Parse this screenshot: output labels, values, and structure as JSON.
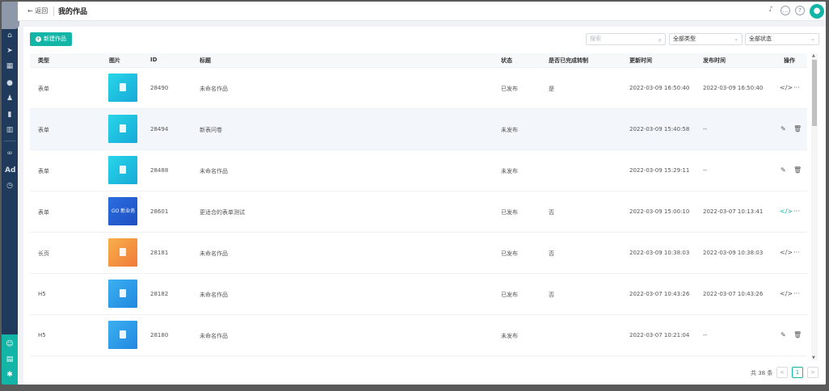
{
  "header": {
    "back_label": "← 返回",
    "title": "我的作品"
  },
  "toolbar": {
    "new_button_label": "新建作品",
    "search_placeholder": "搜索",
    "type_filter": "全部类型",
    "status_filter": "全部状态"
  },
  "table": {
    "columns": [
      "类型",
      "图片",
      "ID",
      "标题",
      "状态",
      "是否已完成转制",
      "更新时间",
      "发布时间",
      "操作"
    ],
    "rows": [
      {
        "type": "表单",
        "id": "28490",
        "title": "未命名作品",
        "status": "已发布",
        "converted": "是",
        "updated": "2022-03-09 16:50:40",
        "published": "2022-03-09 16:50:40",
        "thumb": "cyan",
        "actions": "embed"
      },
      {
        "type": "表单",
        "id": "28494",
        "title": "新表问卷",
        "status": "未发布",
        "converted": "",
        "updated": "2022-03-09 15:40:58",
        "published": "--",
        "thumb": "cyan",
        "actions": "edit"
      },
      {
        "type": "表单",
        "id": "28488",
        "title": "未命名作品",
        "status": "未发布",
        "converted": "",
        "updated": "2022-03-09 15:29:11",
        "published": "--",
        "thumb": "cyan",
        "actions": "edit"
      },
      {
        "type": "表单",
        "id": "28601",
        "title": "更适合的表单测试",
        "status": "已发布",
        "converted": "否",
        "updated": "2022-03-09 15:00:10",
        "published": "2022-03-07 10:13:41",
        "thumb": "blue",
        "thumb_text": "GO 新业务",
        "actions": "embed-teal"
      },
      {
        "type": "长页",
        "id": "28181",
        "title": "未命名作品",
        "status": "已发布",
        "converted": "否",
        "updated": "2022-03-09 10:38:03",
        "published": "2022-03-09 10:38:03",
        "thumb": "orange",
        "actions": "embed"
      },
      {
        "type": "H5",
        "id": "28182",
        "title": "未命名作品",
        "status": "已发布",
        "converted": "否",
        "updated": "2022-03-07 10:43:26",
        "published": "2022-03-07 10:43:26",
        "thumb": "sky",
        "actions": "embed"
      },
      {
        "type": "H5",
        "id": "28180",
        "title": "未命名作品",
        "status": "未发布",
        "converted": "",
        "updated": "2022-03-07 10:21:04",
        "published": "--",
        "thumb": "sky",
        "actions": "edit"
      }
    ]
  },
  "pagination": {
    "total_label": "共 38 条",
    "current_page": "1",
    "prev": "<",
    "next": ">"
  },
  "colors": {
    "accent": "#13b5a6",
    "sidebar": "#1f3a5a"
  },
  "icons": {
    "sidebar": [
      "home-icon",
      "send-icon",
      "grid-icon",
      "user-icon",
      "users-icon",
      "bookmark-icon",
      "chart-icon",
      "link-icon",
      "ad-icon",
      "clock-icon"
    ],
    "sidebar_bottom": [
      "team-icon",
      "document-icon",
      "settings-icon"
    ],
    "header": [
      "bell-icon",
      "message-icon",
      "help-icon",
      "avatar-icon"
    ]
  },
  "sidebar": {
    "ad_label": "Ad"
  }
}
